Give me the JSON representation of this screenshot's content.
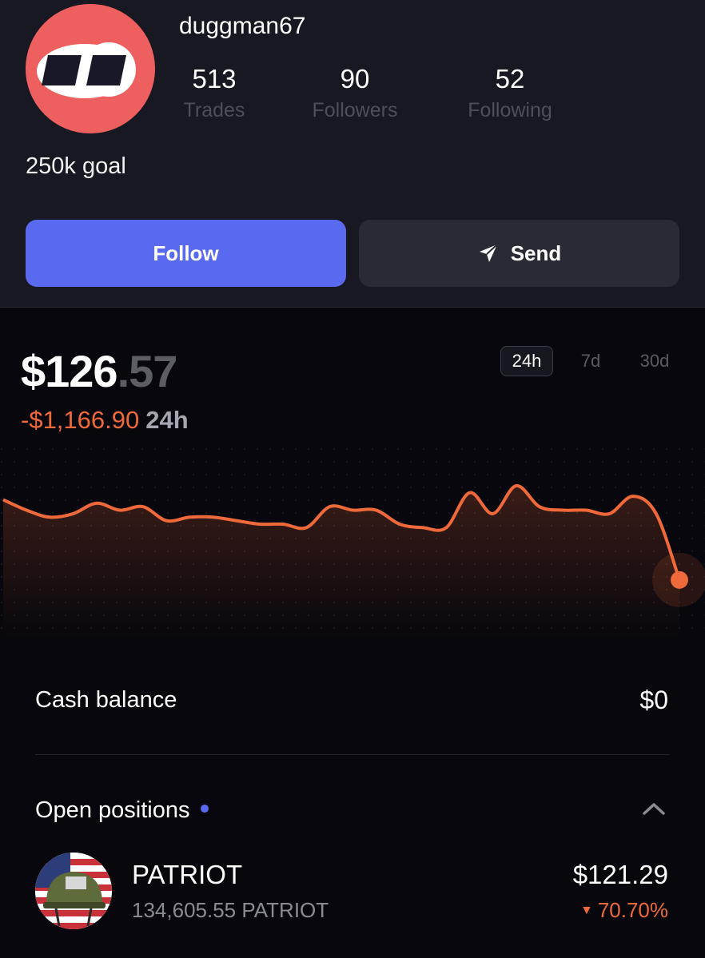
{
  "profile": {
    "username": "duggman67",
    "avatar_icon": "logo-icon",
    "bio": "250k goal",
    "stats": [
      {
        "value": "513",
        "label": "Trades"
      },
      {
        "value": "90",
        "label": "Followers"
      },
      {
        "value": "52",
        "label": "Following"
      }
    ]
  },
  "actions": {
    "follow_label": "Follow",
    "send_label": "Send",
    "send_icon": "send-arrow-icon"
  },
  "portfolio": {
    "value_main": "$126",
    "value_cents": ".57",
    "change_value": "-$1,166.90",
    "change_period": "24h",
    "ranges": [
      "24h",
      "7d",
      "30d"
    ],
    "active_range": "24h"
  },
  "chart_data": {
    "type": "line",
    "title": "",
    "xlabel": "",
    "ylabel": "",
    "grid": false,
    "series": [
      {
        "color": "#f0693a",
        "values": [
          100,
          97,
          95,
          96,
          99,
          97,
          98,
          94,
          95,
          95,
          94,
          93,
          93,
          92,
          98,
          97,
          97,
          93,
          92,
          92,
          102,
          96,
          104,
          98,
          97,
          97,
          96,
          101,
          96,
          77
        ]
      }
    ],
    "ylim": [
      60,
      115
    ]
  },
  "balances": {
    "cash_label": "Cash balance",
    "cash_value": "$0",
    "positions_label": "Open positions"
  },
  "positions": [
    {
      "name": "PATRIOT",
      "amount": "134,605.55 PATRIOT",
      "value": "$121.29",
      "change": "70.70%",
      "direction": "down",
      "icon": "patriot-token-icon"
    }
  ],
  "colors": {
    "accent": "#5a6af0",
    "negative": "#f0693a",
    "avatar_bg": "#ee5f5f"
  }
}
